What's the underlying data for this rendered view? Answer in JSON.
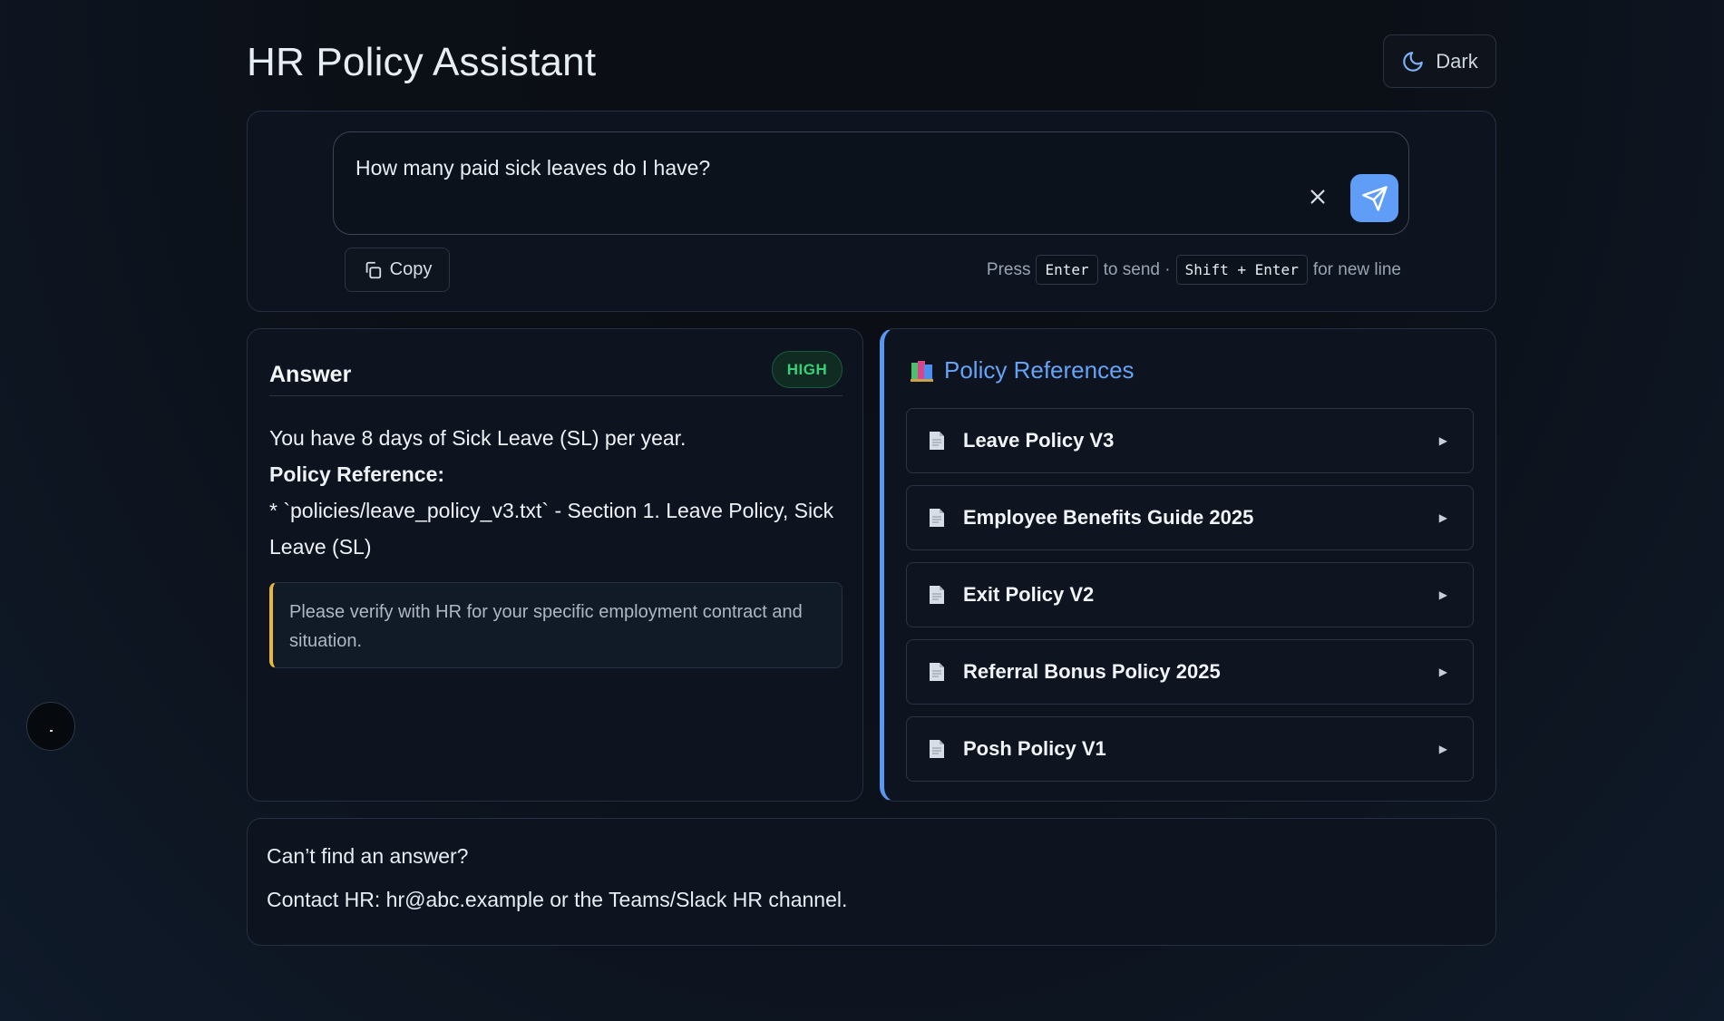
{
  "app": {
    "title": "HR Policy Assistant"
  },
  "theme_toggle": {
    "label": "Dark",
    "icon": "moon-icon"
  },
  "query": {
    "value": "How many paid sick leaves do I have?",
    "clear_icon": "close-icon",
    "send_icon": "send-icon",
    "copy_label": "Copy",
    "hint": {
      "press": "Press",
      "key_send": "Enter",
      "to_send": "to send ·",
      "key_newline": "Shift + Enter",
      "for_new_line": "for new line"
    }
  },
  "answer": {
    "title": "Answer",
    "confidence": "HIGH",
    "confidence_color": "#37d17a",
    "line1": "You have 8 days of Sick Leave (SL) per year.",
    "ref_heading": "Policy Reference:",
    "ref_line": "* `policies/leave_policy_v3.txt` - Section 1. Leave Policy, Sick Leave (SL)",
    "note": "Please verify with HR for your specific employment contract and situation."
  },
  "references": {
    "title": "Policy References",
    "icon": "books-icon",
    "items": [
      {
        "label": "Leave Policy V3"
      },
      {
        "label": "Employee Benefits Guide 2025"
      },
      {
        "label": "Exit Policy V2"
      },
      {
        "label": "Referral Bonus Policy 2025"
      },
      {
        "label": "Posh Policy V1"
      }
    ]
  },
  "contact": {
    "question": "Can’t find an answer?",
    "text": "Contact HR: hr@abc.example or the Teams/Slack HR channel."
  },
  "colors": {
    "accent": "#5f9df7",
    "warning": "#e9b73d",
    "background": "#0c111a"
  }
}
